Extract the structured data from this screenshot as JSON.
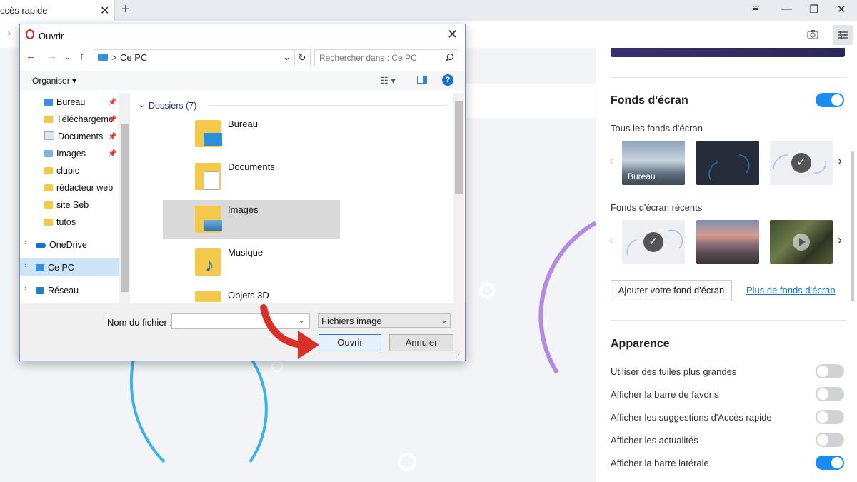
{
  "browser": {
    "tab_label": "ccès rapide",
    "tab_close": "✕",
    "new_tab": "+"
  },
  "settings_panel": {
    "wallpapers": {
      "heading": "Fonds d'écran",
      "enabled": true,
      "all_label": "Tous les fonds d'écran",
      "all_thumbs": [
        {
          "label": "Bureau",
          "selected": false
        },
        {
          "label": "",
          "selected": false
        },
        {
          "label": "",
          "selected": true
        }
      ],
      "recent_label": "Fonds d'écran récents",
      "recent_thumbs": [
        {
          "selected": true
        },
        {
          "selected": false
        },
        {
          "selected": false
        }
      ],
      "add_button": "Ajouter votre fond d'écran",
      "more_link": "Plus de fonds d'écran"
    },
    "appearance": {
      "heading": "Apparence",
      "options": [
        {
          "label": "Utiliser des tuiles plus grandes",
          "on": false
        },
        {
          "label": "Afficher la barre de favoris",
          "on": false
        },
        {
          "label": "Afficher les suggestions d'Accès rapide",
          "on": false
        },
        {
          "label": "Afficher les actualités",
          "on": false
        },
        {
          "label": "Afficher la barre latérale",
          "on": true
        }
      ]
    }
  },
  "dialog": {
    "title": "Ouvrir",
    "path": "Ce PC",
    "path_separator": ">",
    "search_placeholder": "Rechercher dans : Ce PC",
    "organize": "Organiser",
    "sidebar": {
      "quick_access": [
        {
          "label": "Bureau",
          "pinned": true
        },
        {
          "label": "Téléchargeme",
          "pinned": true
        },
        {
          "label": "Documents",
          "pinned": true
        },
        {
          "label": "Images",
          "pinned": true
        },
        {
          "label": "clubic",
          "pinned": false
        },
        {
          "label": "rédacteur web",
          "pinned": false
        },
        {
          "label": "site Seb",
          "pinned": false
        },
        {
          "label": "tutos",
          "pinned": false
        }
      ],
      "locations": [
        {
          "label": "OneDrive",
          "selected": false
        },
        {
          "label": "Ce PC",
          "selected": true
        },
        {
          "label": "Réseau",
          "selected": false
        }
      ]
    },
    "group_header": "Dossiers (7)",
    "folders": [
      {
        "name": "Bureau",
        "selected": false
      },
      {
        "name": "Documents",
        "selected": false
      },
      {
        "name": "Images",
        "selected": true
      },
      {
        "name": "Musique",
        "selected": false
      },
      {
        "name": "Objets 3D",
        "selected": false
      }
    ],
    "filename_label": "Nom du fichier :",
    "filename_value": "",
    "filetype": "Fichiers image",
    "open_button": "Ouvrir",
    "cancel_button": "Annuler"
  },
  "colors": {
    "accent": "#1a8cf0",
    "annotation_arrow": "#d9302a"
  }
}
